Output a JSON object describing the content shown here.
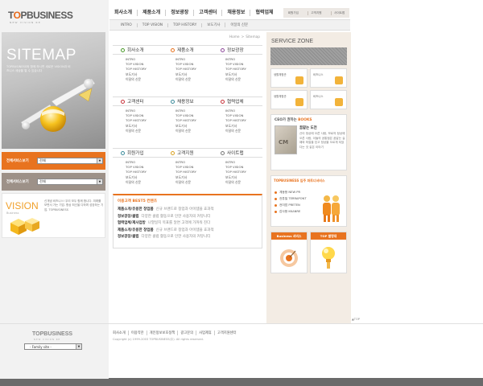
{
  "header": {
    "logo": {
      "prefix": "T",
      "highlight": "O",
      "suffix": "PBUSINESS",
      "tagline": "NEW VISION RE"
    },
    "gnb": [
      "회사소개",
      "제품소개",
      "정보광장",
      "고객센터",
      "채용정보",
      "협력업체"
    ],
    "util": [
      "회원가입",
      "고객지원",
      "사이트맵"
    ],
    "subnav": [
      "INTRO",
      "TOP VISION",
      "TOP HISTORY",
      "보도기사",
      "이달의 신문"
    ]
  },
  "hero": {
    "title": "SITEMAP",
    "text": "TOPBUSINESS와 함께 하시면 새로운 VISION과 비즈니스 세상을 열 수 있습니다"
  },
  "selectors": {
    "orange": {
      "label": "전체서비스보기",
      "value": "전체"
    },
    "gray": {
      "label": "전체서비스보기",
      "value": "전체"
    }
  },
  "vision": {
    "title": "VISION",
    "sub": "Business",
    "text": "신개념 비즈니스! 우리 모두 함께 합니다. 미래를 보면서 가는 기업. 항상 최선을 다하며 성장하는 기업. TOPBUSINESS"
  },
  "breadcrumb": {
    "home": "Home",
    "sep": ">",
    "current": "Sitemap"
  },
  "sitemap": {
    "row1": [
      {
        "title": "회사소개",
        "links": [
          "INTRO",
          "TOP VISION",
          "TOP HISTORY",
          "보도기사",
          "이달의 신문"
        ]
      },
      {
        "title": "제품소개",
        "links": [
          "INTRO",
          "TOP VISION",
          "TOP HISTORY",
          "보도기사",
          "이달의 신문"
        ]
      },
      {
        "title": "정보광장",
        "links": [
          "INTRO",
          "TOP VISION",
          "TOP HISTORY",
          "보도기사",
          "이달의 신문"
        ]
      }
    ],
    "row2": [
      {
        "title": "고객센터",
        "links": [
          "INTRO",
          "TOP VISION",
          "TOP HISTORY",
          "보도기사",
          "이달의 신문"
        ]
      },
      {
        "title": "채용정보",
        "links": [
          "INTRO",
          "TOP VISION",
          "TOP HISTORY",
          "보도기사",
          "이달의 신문"
        ]
      },
      {
        "title": "협력업체",
        "links": [
          "INTRO",
          "TOP VISION",
          "TOP HISTORY",
          "보도기사",
          "이달의 신문"
        ]
      }
    ],
    "row3": [
      {
        "title": "회원가입",
        "links": [
          "INTRO",
          "TOP VISION",
          "TOP HISTORY",
          "보도기사",
          "이달의 신문"
        ]
      },
      {
        "title": "고객지원",
        "links": [
          "INTRO",
          "TOP VISION",
          "TOP HISTORY",
          "보도기사",
          "이달의 신문"
        ]
      },
      {
        "title": "사이트맵",
        "links": [
          "INTRO",
          "TOP VISION",
          "TOP HISTORY",
          "보도기사",
          "이달의 신문"
        ]
      }
    ]
  },
  "best": {
    "title": "이용고객 BEST5 컨텐츠",
    "items": [
      {
        "key": "제품소개/유용한 창업품",
        "desc": "신규 브랜드로 창업과 아이템을 효과적"
      },
      {
        "key": "정보광장/클럽",
        "desc": "다양한 클럽 활동으로 인한 사용자의 커뮤니티"
      },
      {
        "key": "협력업체/제사업방",
        "desc": "나열일지 목표를 달면 고객에 가까워 진다"
      },
      {
        "key": "제품소개/유용한 창업품",
        "desc": "신규 브랜드로 창업과 아이템을 효과적"
      },
      {
        "key": "정보광장/클럽",
        "desc": "다양한 클럽 활동으로 인한 사용자의 커뮤니티"
      }
    ]
  },
  "service_zone": {
    "title": "SERVICE ZONE",
    "cells": [
      "생활체험관",
      "비즈니스",
      "생활체험관",
      "비즈니스"
    ]
  },
  "books": {
    "title_prefix": "CEO가 권하는",
    "title_accent": "BOOKS",
    "cover": "CM",
    "head": "꿈같는 도전",
    "text": "산이 정상에 오른 사람, 보로의 정상에 오른 사람, 이들의 공통점은 꿈같는 실패와 좌절을 딛고 정상을 오르게 되었다는 것 같은 이야기"
  },
  "partner": {
    "title": "TOPBUSINESS 입주 파트너서비스",
    "items": [
      "계동팡 NEW PR",
      "컨튜필 TERRAPONT",
      "컨미엄 PRETEN",
      "감사팡 KKANRE"
    ]
  },
  "promos": {
    "a": "Business 서비스",
    "b": "TOP 발명대"
  },
  "top_link": "▲TOP",
  "footer": {
    "logo": "TOPBUSINESS",
    "logo_sub": "NEW VISION RE",
    "family_site": "- Family site -",
    "links": [
      "회사소개",
      "이용약관",
      "개인정보보호정책",
      "광고문의",
      "사업제휴",
      "고객지원센터"
    ],
    "copyright": "Copyright (c) 1999-2003 TOPBUSINESS(주). All rights reserved."
  },
  "colors": {
    "accent": "#e8731f",
    "panel_gray": "#9d9188",
    "right_panel": "#f3ece4",
    "outer_bg": "#6a6a6a"
  }
}
